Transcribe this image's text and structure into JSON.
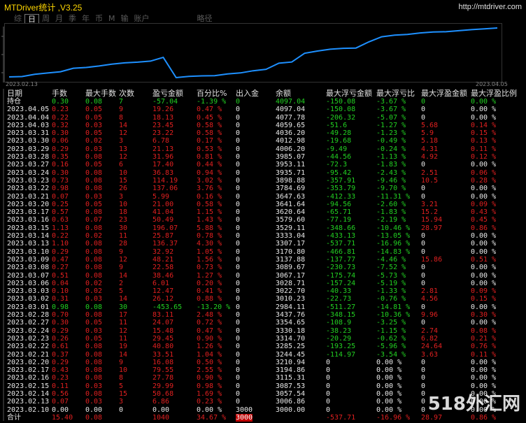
{
  "window": {
    "title": "MTDriver统计 ,V3.25",
    "url": "http://mtdriver.com"
  },
  "tabs": [
    "综",
    "日",
    "周",
    "月",
    "季",
    "年",
    "币",
    "M",
    "输",
    "账户",
    "略径"
  ],
  "active_tab": 1,
  "chart": {
    "date_start": "2023.02.13",
    "date_end": "2023.04.05",
    "color": "#1e90ff"
  },
  "headers": [
    "日期",
    "手数",
    "最大手数",
    "次数",
    "盈亏金额",
    "百分比%",
    "出入金",
    "余额",
    "最大浮亏金额",
    "最大浮亏比",
    "最大浮盈金额",
    "最大浮盈比例"
  ],
  "hold_row": [
    "持仓",
    "0.30",
    "0.08",
    "7",
    "-57.04",
    "-1.39 %",
    "0",
    "4097.04",
    "-150.08",
    "-3.67 %",
    "0",
    "0.00 %"
  ],
  "rows": [
    [
      "2023.04.05",
      "0.23",
      "0.05",
      "9",
      "19.26",
      "0.47 %",
      "0",
      "4097.04",
      "-150.08",
      "-3.67 %",
      "0",
      "0.00 %"
    ],
    [
      "2023.04.04",
      "0.22",
      "0.05",
      "8",
      "18.13",
      "0.45 %",
      "0",
      "4077.78",
      "-206.32",
      "-5.07 %",
      "0",
      "0.00 %"
    ],
    [
      "2023.04.03",
      "0.32",
      "0.03",
      "14",
      "23.45",
      "0.58 %",
      "0",
      "4059.65",
      "-51.6",
      "-1.27 %",
      "5.68",
      "0.14 %"
    ],
    [
      "2023.03.31",
      "0.30",
      "0.05",
      "12",
      "23.22",
      "0.58 %",
      "0",
      "4036.20",
      "-49.28",
      "-1.23 %",
      "5.9",
      "0.15 %"
    ],
    [
      "2023.03.30",
      "0.06",
      "0.02",
      "3",
      "6.78",
      "0.17 %",
      "0",
      "4012.98",
      "-19.68",
      "-0.49 %",
      "5.18",
      "0.13 %"
    ],
    [
      "2023.03.29",
      "0.29",
      "0.03",
      "13",
      "21.13",
      "0.53 %",
      "0",
      "4006.20",
      "-9.49",
      "-0.24 %",
      "4.31",
      "0.11 %"
    ],
    [
      "2023.03.28",
      "0.35",
      "0.08",
      "12",
      "31.96",
      "0.81 %",
      "0",
      "3985.07",
      "-44.56",
      "-1.13 %",
      "4.92",
      "0.12 %"
    ],
    [
      "2023.03.27",
      "0.16",
      "0.05",
      "6",
      "17.40",
      "0.44 %",
      "0",
      "3953.11",
      "-72.3",
      "-1.83 %",
      "0",
      "0.00 %"
    ],
    [
      "2023.03.24",
      "0.30",
      "0.08",
      "10",
      "36.83",
      "0.94 %",
      "0",
      "3935.71",
      "-95.42",
      "-2.43 %",
      "2.51",
      "0.06 %"
    ],
    [
      "2023.03.23",
      "0.73",
      "0.08",
      "15",
      "114.19",
      "3.02 %",
      "0",
      "3898.88",
      "-357.91",
      "-9.46 %",
      "10.5",
      "0.28 %"
    ],
    [
      "2023.03.22",
      "0.98",
      "0.08",
      "26",
      "137.06",
      "3.76 %",
      "0",
      "3784.69",
      "-353.79",
      "-9.70 %",
      "0",
      "0.00 %"
    ],
    [
      "2023.03.21",
      "0.07",
      "0.03",
      "3",
      "5.99",
      "0.16 %",
      "0",
      "3647.63",
      "-412.33",
      "-11.31 %",
      "0",
      "0.00 %"
    ],
    [
      "2023.03.20",
      "0.25",
      "0.05",
      "10",
      "21.00",
      "0.58 %",
      "0",
      "3641.64",
      "-94.56",
      "-2.60 %",
      "3.21",
      "0.09 %"
    ],
    [
      "2023.03.17",
      "0.57",
      "0.08",
      "18",
      "41.04",
      "1.15 %",
      "0",
      "3620.64",
      "-65.71",
      "-1.83 %",
      "15.2",
      "0.43 %"
    ],
    [
      "2023.03.16",
      "0.63",
      "0.07",
      "23",
      "50.49",
      "1.43 %",
      "0",
      "3579.60",
      "-77.19",
      "-2.19 %",
      "15.94",
      "0.45 %"
    ],
    [
      "2023.03.15",
      "1.13",
      "0.08",
      "30",
      "196.07",
      "5.88 %",
      "0",
      "3529.11",
      "-348.66",
      "-10.46 %",
      "28.97",
      "0.86 %"
    ],
    [
      "2023.03.14",
      "0.22",
      "0.02",
      "11",
      "25.87",
      "0.78 %",
      "0",
      "3333.04",
      "-433.13",
      "-13.05 %",
      "0",
      "0.00 %"
    ],
    [
      "2023.03.13",
      "1.10",
      "0.08",
      "28",
      "136.37",
      "4.30 %",
      "0",
      "3307.17",
      "-537.71",
      "-16.96 %",
      "0",
      "0.00 %"
    ],
    [
      "2023.03.10",
      "0.29",
      "0.08",
      "9",
      "32.92",
      "1.05 %",
      "0",
      "3170.80",
      "-466.81",
      "-14.83 %",
      "0",
      "0.00 %"
    ],
    [
      "2023.03.09",
      "0.47",
      "0.08",
      "12",
      "48.21",
      "1.56 %",
      "0",
      "3137.88",
      "-137.77",
      "-4.46 %",
      "15.86",
      "0.51 %"
    ],
    [
      "2023.03.08",
      "0.27",
      "0.08",
      "9",
      "22.58",
      "0.73 %",
      "0",
      "3089.67",
      "-230.73",
      "-7.52 %",
      "0",
      "0.00 %"
    ],
    [
      "2023.03.07",
      "0.51",
      "0.08",
      "14",
      "38.46",
      "1.27 %",
      "0",
      "3067.17",
      "-175.74",
      "-5.73 %",
      "0",
      "0.00 %"
    ],
    [
      "2023.03.06",
      "0.04",
      "0.02",
      "2",
      "6.01",
      "0.20 %",
      "0",
      "3028.71",
      "-157.24",
      "-5.19 %",
      "0",
      "0.00 %"
    ],
    [
      "2023.03.03",
      "0.10",
      "0.02",
      "5",
      "12.47",
      "0.41 %",
      "0",
      "3022.70",
      "-40.33",
      "-1.33 %",
      "2.81",
      "0.09 %"
    ],
    [
      "2023.03.02",
      "0.31",
      "0.03",
      "14",
      "26.12",
      "0.88 %",
      "0",
      "3010.23",
      "-22.73",
      "-0.76 %",
      "4.56",
      "0.15 %"
    ],
    [
      "2023.03.01",
      "0.98",
      "0.08",
      "30",
      "-453.65",
      "-13.20 %",
      "0",
      "2984.11",
      "-511.27",
      "-14.81 %",
      "0",
      "0.00 %"
    ],
    [
      "2023.02.28",
      "0.70",
      "0.08",
      "17",
      "83.11",
      "2.48 %",
      "0",
      "3437.76",
      "-348.15",
      "-10.36 %",
      "9.96",
      "0.30 %"
    ],
    [
      "2023.02.27",
      "0.30",
      "0.05",
      "11",
      "24.07",
      "0.72 %",
      "0",
      "3354.65",
      "-108.9",
      "-3.25 %",
      "0",
      "0.00 %"
    ],
    [
      "2023.02.24",
      "0.29",
      "0.03",
      "12",
      "15.48",
      "0.47 %",
      "0",
      "3330.18",
      "-38.23",
      "-1.15 %",
      "2.74",
      "0.08 %"
    ],
    [
      "2023.02.23",
      "0.26",
      "0.05",
      "11",
      "29.45",
      "0.90 %",
      "0",
      "3314.70",
      "-20.29",
      "-0.62 %",
      "6.82",
      "0.21 %"
    ],
    [
      "2023.02.22",
      "0.61",
      "0.08",
      "19",
      "40.80",
      "1.26 %",
      "0",
      "3285.25",
      "-193.25",
      "-5.96 %",
      "24.64",
      "0.76 %"
    ],
    [
      "2023.02.21",
      "0.37",
      "0.08",
      "14",
      "33.51",
      "1.04 %",
      "0",
      "3244.45",
      "-114.97",
      "-3.54 %",
      "3.63",
      "0.11 %"
    ],
    [
      "2023.02.20",
      "0.29",
      "0.08",
      "9",
      "16.08",
      "0.50 %",
      "0",
      "3210.94",
      "0",
      "0.00 %",
      "0",
      "0.00 %"
    ],
    [
      "2023.02.17",
      "0.43",
      "0.08",
      "10",
      "79.55",
      "2.55 %",
      "0",
      "3194.86",
      "0",
      "0.00 %",
      "0",
      "0.00 %"
    ],
    [
      "2023.02.16",
      "0.23",
      "0.08",
      "8",
      "27.78",
      "0.90 %",
      "0",
      "3115.31",
      "0",
      "0.00 %",
      "0",
      "0.00 %"
    ],
    [
      "2023.02.15",
      "0.11",
      "0.03",
      "5",
      "29.99",
      "0.98 %",
      "0",
      "3087.53",
      "0",
      "0.00 %",
      "0",
      "0.00 %"
    ],
    [
      "2023.02.14",
      "0.56",
      "0.08",
      "15",
      "50.68",
      "1.69 %",
      "0",
      "3057.54",
      "0",
      "0.00 %",
      "0",
      "0.00 %"
    ],
    [
      "2023.02.13",
      "0.07",
      "0.03",
      "3",
      "6.86",
      "0.23 %",
      "0",
      "3006.86",
      "0",
      "0.00 %",
      "0",
      "0.00 %"
    ],
    [
      "2023.02.10",
      "0.00",
      "0.00",
      "0",
      "0.00",
      "0.00 %",
      "3000",
      "3000.00",
      "0",
      "0.00 %",
      "0",
      "0.00 %"
    ]
  ],
  "total_row": [
    "合计",
    "15.40",
    "0.08",
    "",
    "1040",
    "34.67 %",
    "3000",
    "",
    "-537.71",
    "-16.96 %",
    "28.97",
    "0.86 %"
  ],
  "watermark": "518外汇网"
}
